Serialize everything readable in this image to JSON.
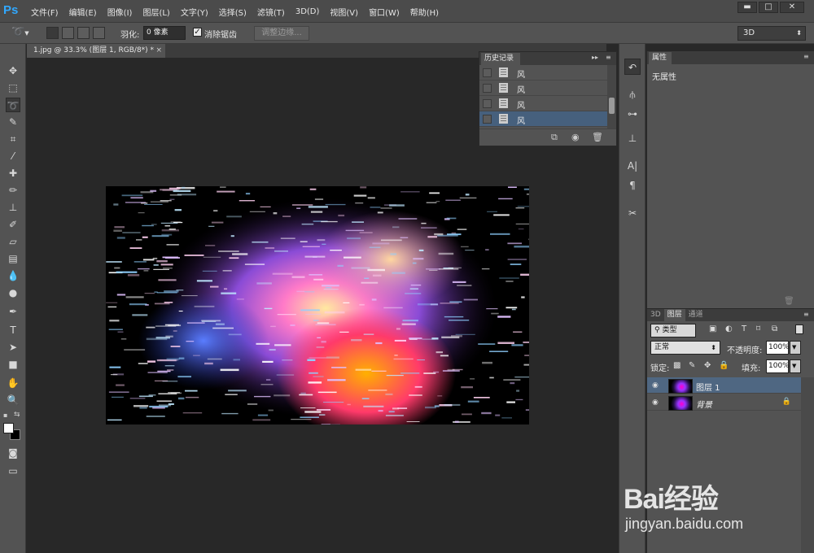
{
  "app": {
    "logo": "Ps"
  },
  "menu": [
    "文件(F)",
    "编辑(E)",
    "图像(I)",
    "图层(L)",
    "文字(Y)",
    "选择(S)",
    "滤镜(T)",
    "3D(D)",
    "视图(V)",
    "窗口(W)",
    "帮助(H)"
  ],
  "window_controls": {
    "minimize": "▬",
    "maximize": "□",
    "close": "✕"
  },
  "options": {
    "feather_label": "羽化:",
    "feather_value": "0 像素",
    "antialias_label": "消除锯齿",
    "antialias_checked": true,
    "refine_edge_label": "调整边缘...",
    "workspace": "3D"
  },
  "document": {
    "tab_title": "1.jpg @ 33.3% (图层 1, RGB/8*) *",
    "close": "×"
  },
  "history": {
    "title": "历史记录",
    "items": [
      {
        "label": "风",
        "active": false
      },
      {
        "label": "风",
        "active": false
      },
      {
        "label": "风",
        "active": false
      },
      {
        "label": "风",
        "active": true
      }
    ]
  },
  "properties": {
    "title": "属性",
    "empty_text": "无属性"
  },
  "layers": {
    "tabs": [
      {
        "label": "3D",
        "active": false
      },
      {
        "label": "图层",
        "active": true
      },
      {
        "label": "通道",
        "active": false
      }
    ],
    "filter_kind": "类型",
    "blend_mode": "正常",
    "opacity_label": "不透明度:",
    "opacity_value": "100%",
    "lock_label": "锁定:",
    "fill_label": "填充:",
    "fill_value": "100%",
    "items": [
      {
        "name": "图层 1",
        "active": true,
        "locked": false
      },
      {
        "name": "背景",
        "active": false,
        "locked": true
      }
    ]
  },
  "watermark": {
    "brand": "Bai经验",
    "url": "jingyan.baidu.com"
  },
  "colors": {
    "foreground": "#ffffff",
    "background": "#000000",
    "accent_selection": "#46607d"
  }
}
